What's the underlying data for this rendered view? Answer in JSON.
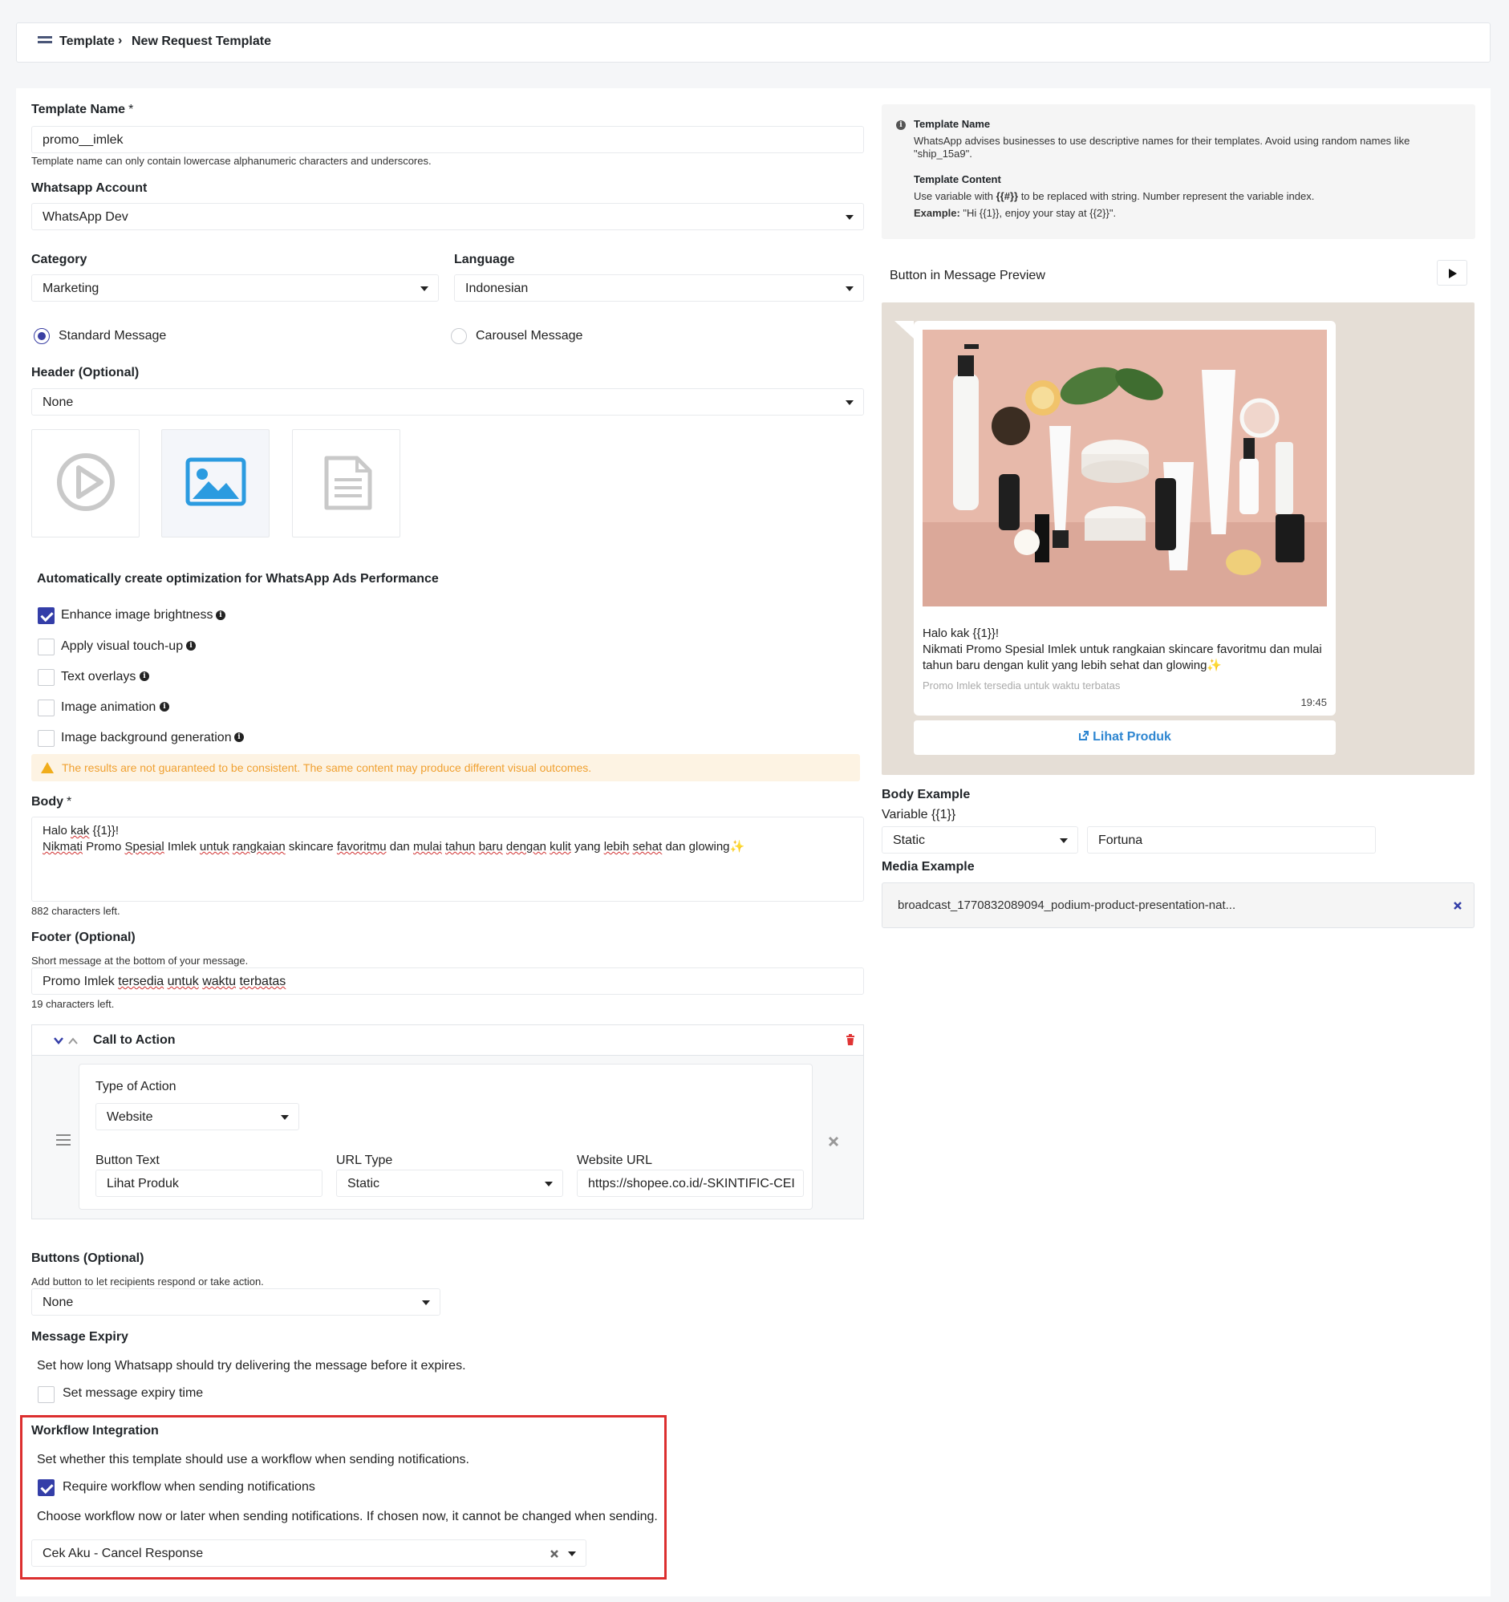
{
  "breadcrumb": {
    "root": "Template",
    "separator": "›",
    "current": "New Request Template"
  },
  "form": {
    "template_name": {
      "label": "Template Name",
      "required_mark": "*",
      "value": "promo__imlek",
      "help": "Template name can only contain lowercase alphanumeric characters and underscores."
    },
    "whatsapp_account": {
      "label": "Whatsapp Account",
      "value": "WhatsApp Dev"
    },
    "category": {
      "label": "Category",
      "value": "Marketing"
    },
    "language": {
      "label": "Language",
      "value": "Indonesian"
    },
    "message_type": {
      "standard": "Standard Message",
      "carousel": "Carousel Message",
      "selected": "standard"
    },
    "header": {
      "label": "Header (Optional)",
      "value": "None",
      "media_selected": "image"
    },
    "optimization": {
      "title": "Automatically create optimization for WhatsApp Ads Performance",
      "options": [
        {
          "label": "Enhance image brightness",
          "checked": true
        },
        {
          "label": "Apply visual touch-up",
          "checked": false
        },
        {
          "label": "Text overlays",
          "checked": false
        },
        {
          "label": "Image animation",
          "checked": false
        },
        {
          "label": "Image background generation",
          "checked": false
        }
      ],
      "warning": "The results are not guaranteed to be consistent. The same content may produce different visual outcomes."
    },
    "body": {
      "label": "Body",
      "required_mark": "*",
      "line1_a": "Halo ",
      "line1_b": "kak",
      "line1_c": " {{1}}!",
      "line2_a": "Nikmati",
      "line2_b": " Promo ",
      "line2_c": "Spesial",
      "line2_d": " Imlek ",
      "line2_e": "untuk",
      "line2_f": " ",
      "line2_g": "rangkaian",
      "line2_h": " skincare ",
      "line2_i": "favoritmu",
      "line2_j": " dan ",
      "line2_k": "mulai",
      "line2_l": " ",
      "line2_m": "tahun",
      "line2_n": " ",
      "line2_o": "baru",
      "line2_p": " ",
      "line2_q": "dengan",
      "line2_r": " ",
      "line2_s": "kulit",
      "line2_t": " yang ",
      "line2_u": "lebih",
      "line2_v": " ",
      "line2_w": "sehat",
      "line2_x": " dan glowing",
      "line2_y": "✨",
      "chars_left": "882 characters left."
    },
    "footer": {
      "label": "Footer (Optional)",
      "help": "Short message at the bottom of your message.",
      "value_a": "Promo Imlek ",
      "value_b": "tersedia",
      "value_c": " ",
      "value_d": "untuk",
      "value_e": " ",
      "value_f": "waktu",
      "value_g": " ",
      "value_h": "terbatas",
      "chars_left": "19 characters left."
    },
    "cta": {
      "title": "Call to Action",
      "type_label": "Type of Action",
      "type_value": "Website",
      "button_text_label": "Button Text",
      "button_text_value": "Lihat Produk",
      "url_type_label": "URL Type",
      "url_type_value": "Static",
      "website_url_label": "Website URL",
      "website_url_value": "https://shopee.co.id/-SKINTIFIC-CEI"
    },
    "buttons": {
      "label": "Buttons (Optional)",
      "help": "Add button to let recipients respond or take action.",
      "value": "None"
    },
    "expiry": {
      "label": "Message Expiry",
      "help": "Set how long Whatsapp should try delivering the message before it expires.",
      "checkbox": "Set message expiry time",
      "checked": false
    },
    "workflow": {
      "label": "Workflow Integration",
      "help": "Set whether this template should use a workflow when sending notifications.",
      "checkbox": "Require workflow when sending notifications",
      "checked": true,
      "note": "Choose workflow now or later when sending notifications. If chosen now, it cannot be changed when sending.",
      "value": "Cek Aku - Cancel Response"
    }
  },
  "sidebar": {
    "info": {
      "name_title": "Template Name",
      "name_text": "WhatsApp advises businesses to use descriptive names for their templates. Avoid using random names like \"ship_15a9\".",
      "content_title": "Template Content",
      "content_text_a": "Use variable with ",
      "content_text_b": "{{#}}",
      "content_text_c": " to be replaced with string. Number represent the variable index.",
      "example_label": "Example:",
      "example_text": " \"Hi {{1}}, enjoy your stay at {{2}}\"."
    },
    "preview": {
      "title": "Button in Message Preview",
      "line1": "Halo kak {{1}}!",
      "line2": "Nikmati Promo Spesial Imlek untuk rangkaian skincare favoritmu dan mulai tahun baru dengan kulit yang lebih sehat dan glowing✨",
      "footer": "Promo Imlek tersedia untuk waktu terbatas",
      "time": "19:45",
      "button": "Lihat Produk"
    },
    "body_example": {
      "label": "Body Example",
      "variable_label": "Variable {{1}}",
      "type": "Static",
      "value": "Fortuna"
    },
    "media_example": {
      "label": "Media Example",
      "file": "broadcast_1770832089094_podium-product-presentation-nat..."
    }
  },
  "colors": {
    "accent": "#343ea8",
    "link": "#2e86d1",
    "danger": "#dc2f2f",
    "warning": "#f0a030",
    "preview_bg": "#e5ded6"
  }
}
